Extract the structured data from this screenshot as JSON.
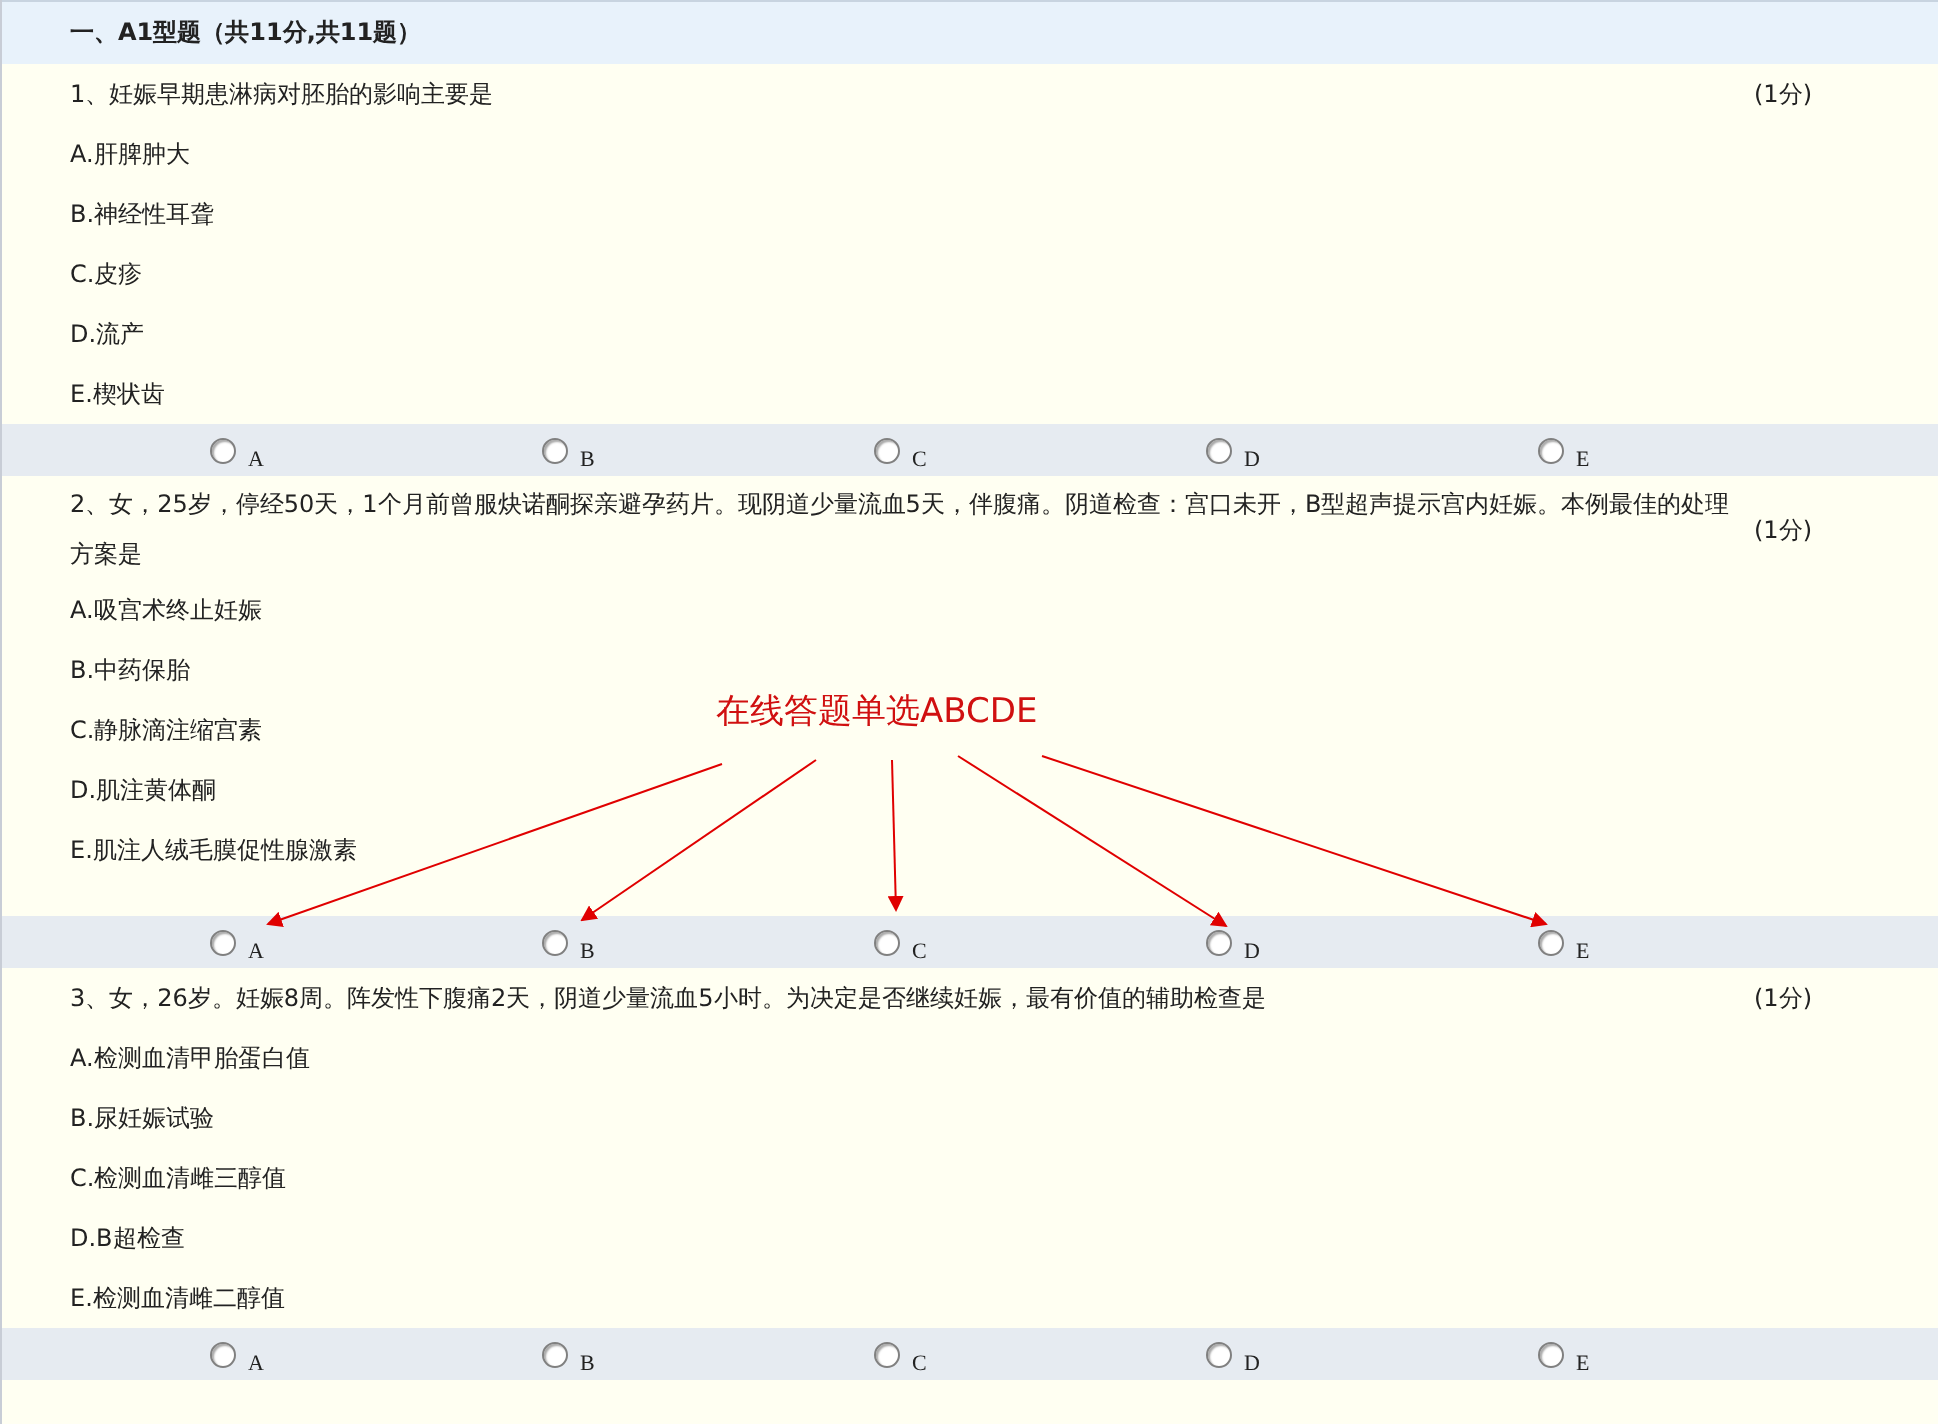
{
  "section_title": "一、A1型题（共11分,共11题）",
  "questions": [
    {
      "text": "1、妊娠早期患淋病对胚胎的影响主要是",
      "score": "(1分)",
      "options": [
        "A.肝脾肿大",
        "B.神经性耳聋",
        "C.皮疹",
        "D.流产",
        "E.楔状齿"
      ],
      "choices": [
        {
          "label": "A",
          "selected": false
        },
        {
          "label": "B",
          "selected": false
        },
        {
          "label": "C",
          "selected": false
        },
        {
          "label": "D",
          "selected": false
        },
        {
          "label": "E",
          "selected": false
        }
      ]
    },
    {
      "text": "2、女，25岁，停经50天，1个月前曾服炔诺酮探亲避孕药片。现阴道少量流血5天，伴腹痛。阴道检查：宫口未开，B型超声提示宫内妊娠。本例最佳的处理方案是",
      "score": "(1分)",
      "options": [
        "A.吸宫术终止妊娠",
        "B.中药保胎",
        "C.静脉滴注缩宫素",
        "D.肌注黄体酮",
        "E.肌注人绒毛膜促性腺激素"
      ],
      "choices": [
        {
          "label": "A",
          "selected": false
        },
        {
          "label": "B",
          "selected": false
        },
        {
          "label": "C",
          "selected": false
        },
        {
          "label": "D",
          "selected": false
        },
        {
          "label": "E",
          "selected": false
        }
      ],
      "annotation": "在线答题单选ABCDE"
    },
    {
      "text": "3、女，26岁。妊娠8周。阵发性下腹痛2天，阴道少量流血5小时。为决定是否继续妊娠，最有价值的辅助检查是",
      "score": "(1分)",
      "options": [
        "A.检测血清甲胎蛋白值",
        "B.尿妊娠试验",
        "C.检测血清雌三醇值",
        "D.B超检查",
        "E.检测血清雌二醇值"
      ],
      "choices": [
        {
          "label": "A",
          "selected": false
        },
        {
          "label": "B",
          "selected": false
        },
        {
          "label": "C",
          "selected": false
        },
        {
          "label": "D",
          "selected": false
        },
        {
          "label": "E",
          "selected": false
        }
      ]
    }
  ]
}
